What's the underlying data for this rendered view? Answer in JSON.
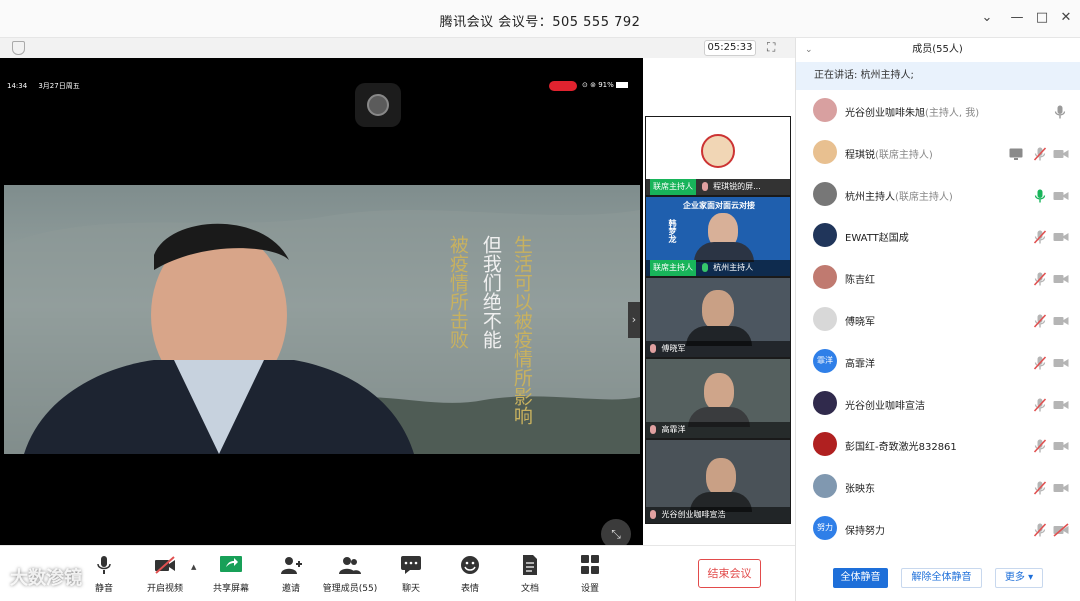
{
  "window": {
    "title": "腾讯会议 会议号：505 555 792",
    "controls": {
      "collapse": "⌄",
      "minimize": "—",
      "maximize": "□",
      "close": "✕"
    }
  },
  "stage": {
    "timer": "05:25:33",
    "phone_status": {
      "time": "14:34",
      "date": "3月27日周五",
      "battery": "91%"
    },
    "poem": [
      {
        "text": "生活可以被疫情所影响",
        "color": "#c8b15f"
      },
      {
        "text": "但我们绝不能",
        "color": "#f0f0f0"
      },
      {
        "text": "被疫情所击败",
        "color": "#c8b15f"
      }
    ]
  },
  "thumbnails": [
    {
      "host_tag": "联席主持人",
      "name": "程琪锐的屏...",
      "mic_muted": true,
      "bg": "#ffffff"
    },
    {
      "host_tag": "联席主持人",
      "name": "杭州主持人",
      "mic_muted": false,
      "banner": "企业家面对面云对接",
      "guest": "韩梦龙",
      "bg": "#1f5fae"
    },
    {
      "host_tag": "",
      "name": "傅晓军",
      "mic_muted": true,
      "bg": "#4c5660"
    },
    {
      "host_tag": "",
      "name": "高霏洋",
      "mic_muted": true,
      "bg": "#55605f"
    },
    {
      "host_tag": "",
      "name": "光谷创业咖啡宣浩",
      "mic_muted": true,
      "bg": "#4a5258"
    }
  ],
  "toolbar": {
    "items": [
      {
        "label": "静音",
        "icon": "mic-icon"
      },
      {
        "label": "开启视频",
        "icon": "video-off-icon"
      },
      {
        "label": "共享屏幕",
        "icon": "share-screen-icon"
      },
      {
        "label": "邀请",
        "icon": "invite-icon"
      },
      {
        "label": "管理成员(55)",
        "icon": "members-icon"
      },
      {
        "label": "聊天",
        "icon": "chat-icon"
      },
      {
        "label": "表情",
        "icon": "emoji-icon"
      },
      {
        "label": "文档",
        "icon": "document-icon"
      },
      {
        "label": "设置",
        "icon": "settings-icon"
      }
    ],
    "end_meeting": "结束会议",
    "watermark": "大数渗镜"
  },
  "panel": {
    "title": "成员(55人)",
    "speaking": "正在讲话: 杭州主持人;",
    "members": [
      {
        "name": "光谷创业咖啡朱旭",
        "role": "(主持人, 我)",
        "avatar": "",
        "avatar_color": "#d8a0a0",
        "mic": "on-gray",
        "cam": ""
      },
      {
        "name": "程琪锐",
        "role": "(联席主持人)",
        "avatar": "",
        "avatar_color": "#e8c090",
        "mic": "muted",
        "cam": "off",
        "sharing": true
      },
      {
        "name": "杭州主持人",
        "role": "(联席主持人)",
        "avatar": "",
        "avatar_color": "#777777",
        "mic": "speaking",
        "cam": "off"
      },
      {
        "name": "EWATT赵国成",
        "role": "",
        "avatar": "",
        "avatar_color": "#20355a",
        "mic": "muted",
        "cam": "off"
      },
      {
        "name": "陈吉红",
        "role": "",
        "avatar": "",
        "avatar_color": "#c07a70",
        "mic": "muted",
        "cam": "off"
      },
      {
        "name": "傅晓军",
        "role": "",
        "avatar": "",
        "avatar_color": "#d8d8d8",
        "mic": "muted",
        "cam": "off"
      },
      {
        "name": "高霏洋",
        "role": "",
        "avatar": "霏洋",
        "avatar_color": "#2f7fe8",
        "mic": "muted",
        "cam": "off"
      },
      {
        "name": "光谷创业咖啡宣洁",
        "role": "",
        "avatar": "",
        "avatar_color": "#302a4c",
        "mic": "muted",
        "cam": "off"
      },
      {
        "name": "彭国红-奇致激光832861",
        "role": "",
        "avatar": "",
        "avatar_color": "#b02020",
        "mic": "muted",
        "cam": "off"
      },
      {
        "name": "张映东",
        "role": "",
        "avatar": "",
        "avatar_color": "#8098b0",
        "mic": "muted",
        "cam": "off"
      },
      {
        "name": "保持努力",
        "role": "",
        "avatar": "努力",
        "avatar_color": "#2f7fe8",
        "mic": "muted",
        "cam": "off-red"
      }
    ],
    "buttons": {
      "mute_all": "全体静音",
      "unmute_all": "解除全体静音",
      "more": "更多 ▾"
    }
  },
  "colors": {
    "accent": "#1e6fd9",
    "muted_red": "#e05050",
    "speaking_green": "#18b45a",
    "end_red": "#e24b4b"
  }
}
